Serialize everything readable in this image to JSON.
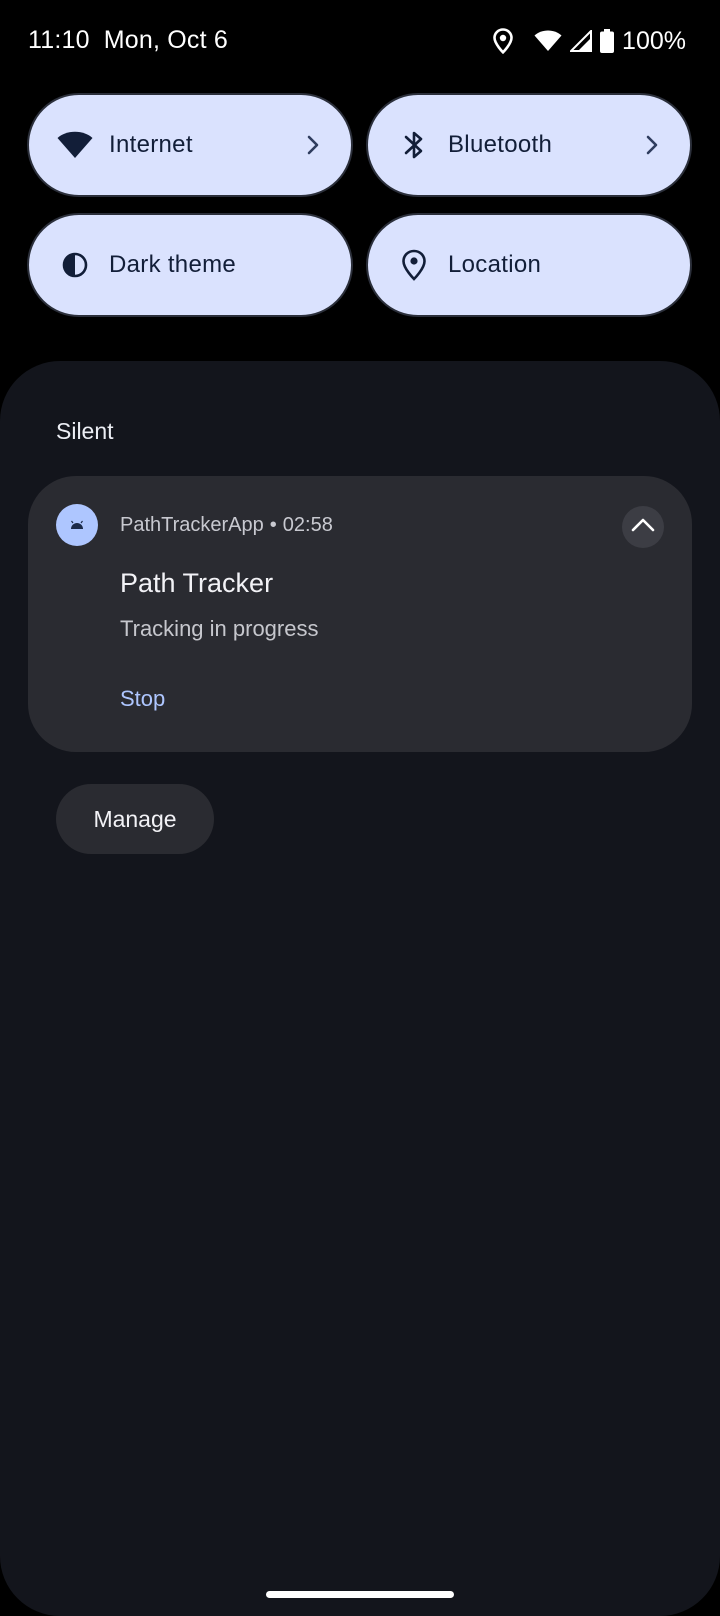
{
  "status_bar": {
    "time": "11:10",
    "date": "Mon, Oct 6",
    "battery": "100%",
    "icons": [
      "location-icon",
      "wifi-icon",
      "cellular-signal-icon",
      "battery-icon"
    ]
  },
  "quick_settings": {
    "tiles": [
      {
        "label": "Internet",
        "icon": "wifi-icon",
        "has_chevron": true
      },
      {
        "label": "Bluetooth",
        "icon": "bluetooth-icon",
        "has_chevron": true
      },
      {
        "label": "Dark theme",
        "icon": "dark-theme-icon",
        "has_chevron": false
      },
      {
        "label": "Location",
        "icon": "location-pin-icon",
        "has_chevron": false
      }
    ]
  },
  "notifications": {
    "section_title": "Silent",
    "items": [
      {
        "app_name": "PathTrackerApp",
        "separator": "•",
        "time": "02:58",
        "title": "Path Tracker",
        "text": "Tracking in progress",
        "action": "Stop",
        "icon": "android-app-icon"
      }
    ],
    "manage_label": "Manage"
  },
  "colors": {
    "tile_bg": "#dae2fe",
    "tile_fg": "#121e38",
    "shade_bg": "#13151c",
    "card_bg": "#2a2b31",
    "accent": "#aec6ff"
  }
}
